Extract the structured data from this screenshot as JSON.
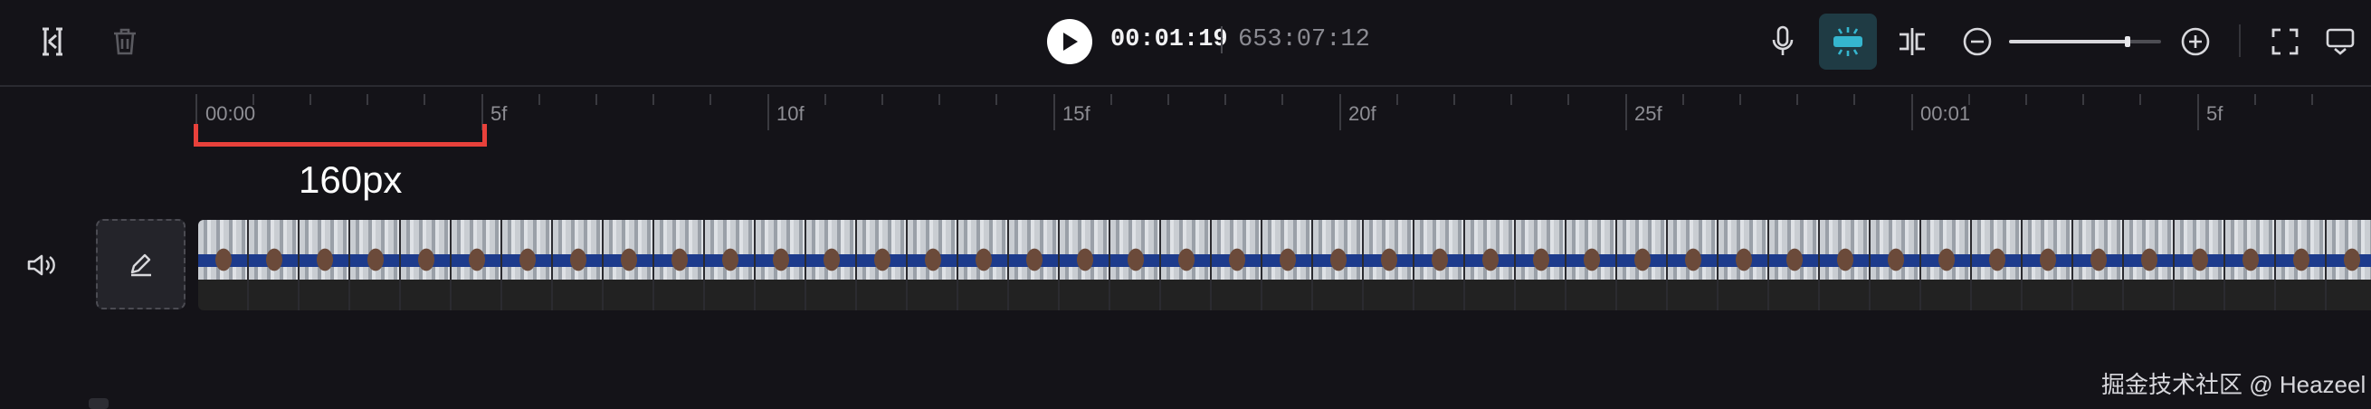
{
  "toolbar": {
    "current_time": "00:01:19",
    "total_time": "653:07:12",
    "zoom_level": 0.78
  },
  "ruler": {
    "labels": [
      "00:00",
      "5f",
      "10f",
      "15f",
      "20f",
      "25f",
      "00:01",
      "5f"
    ]
  },
  "annotation": {
    "text": "160px",
    "color": "#e8413b"
  },
  "watermark": "掘金技术社区 @ Heazeel",
  "icons": {
    "split": "split-icon",
    "delete": "trash-icon",
    "play": "play-icon",
    "mic": "microphone-icon",
    "auto_snap": "magnet-snap-icon",
    "split_align": "split-align-icon",
    "zoom_out": "zoom-out-icon",
    "zoom_in": "zoom-in-icon",
    "fit": "fit-screen-icon",
    "more": "more-icon",
    "audio": "speaker-icon",
    "cover": "edit-cover-icon"
  },
  "colors": {
    "background": "#141318",
    "accent": "#35b6cf",
    "marker": "#e8413b"
  }
}
